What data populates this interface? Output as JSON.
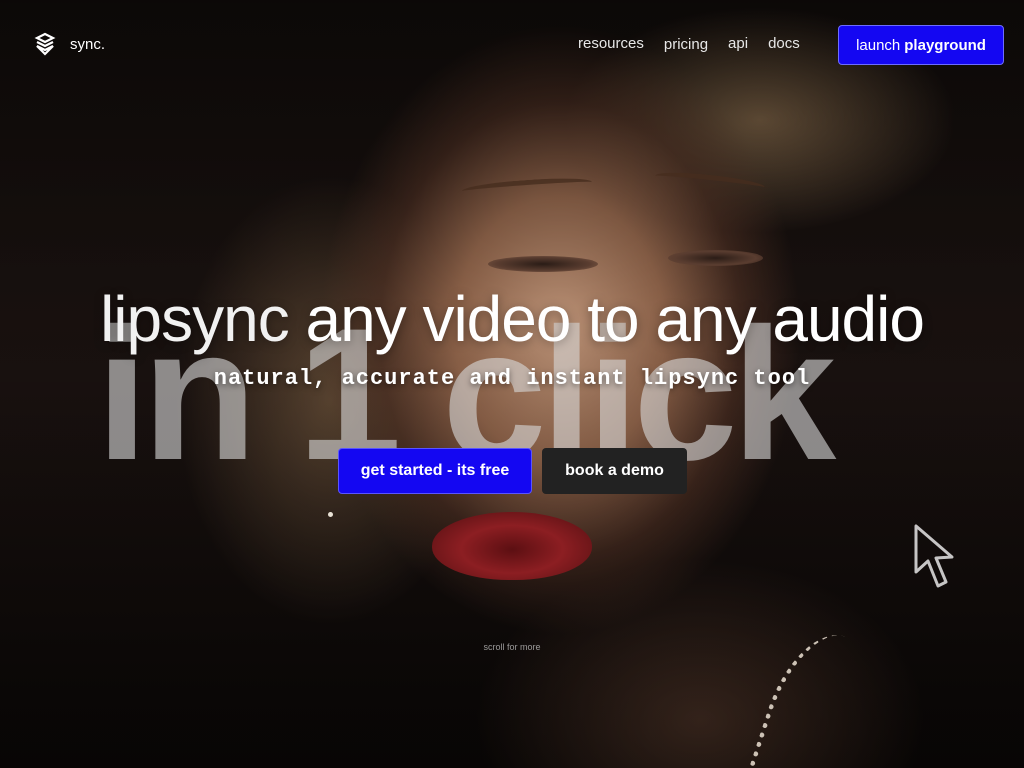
{
  "nav": {
    "brand": "sync.",
    "links": [
      "resources",
      "pricing",
      "api",
      "docs"
    ],
    "launch_prefix": "launch",
    "launch_label": "playground"
  },
  "hero": {
    "background_text": "in 1 click",
    "headline_light": "lipsync",
    "headline_strong": "any video to any audio",
    "subheadline": "natural, accurate and instant lipsync tool",
    "primary_cta": "get started - its free",
    "secondary_cta": "book a demo",
    "scroll_hint": "scroll for more"
  },
  "icons": {
    "logo": "sync-logo-icon",
    "cursor": "mouse-pointer-icon"
  },
  "colors": {
    "accent": "#1407f2",
    "secondary_button": "#222222",
    "text": "#ffffff"
  }
}
